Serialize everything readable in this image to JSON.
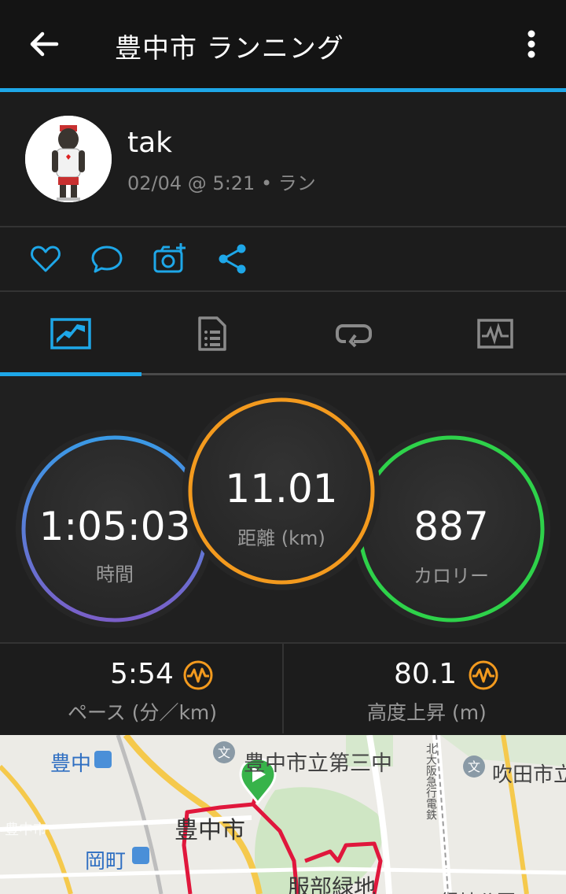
{
  "header": {
    "title": "豊中市 ランニング"
  },
  "user": {
    "name": "tak",
    "meta": "02/04 @ 5:21 • ラン"
  },
  "stats": {
    "time": {
      "value": "1:05:03",
      "label": "時間"
    },
    "distance": {
      "value": "11.01",
      "label": "距離 (km)"
    },
    "calories": {
      "value": "887",
      "label": "カロリー"
    }
  },
  "substats": {
    "pace": {
      "value": "5:54",
      "label": "ペース (分／km)"
    },
    "elevation": {
      "value": "80.1",
      "label": "高度上昇 (m)"
    }
  },
  "map": {
    "labels": {
      "toyonaka_station": "豊中",
      "school": "豊中市立第三中",
      "railway": "北大阪急行電鉄",
      "suita": "吹田市立",
      "toyonaka_city": "豊中市",
      "okamachi": "岡町",
      "toyonaka_small": "豊中市",
      "hattori": "服部緑地",
      "park": "緑地公園"
    }
  },
  "colors": {
    "accent": "#1ea7e8",
    "time_ring_top": "#3a9ae6",
    "time_ring_bottom": "#7a5fc8",
    "distance_ring": "#f39a1e",
    "calories_ring": "#2ed24a",
    "route": "#e0173c",
    "start_marker": "#37b34a"
  },
  "icons": [
    "back-arrow-icon",
    "more-vert-icon",
    "heart-icon",
    "comment-icon",
    "add-photo-icon",
    "share-icon",
    "overview-tab-icon",
    "details-tab-icon",
    "laps-tab-icon",
    "charts-tab-icon",
    "heart-rate-zone-icon"
  ]
}
